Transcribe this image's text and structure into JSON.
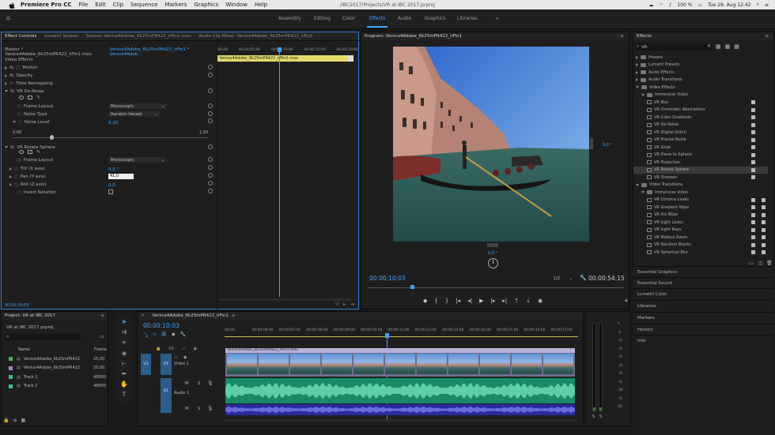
{
  "menubar": {
    "app": "Premiere Pro CC",
    "items": [
      "File",
      "Edit",
      "Clip",
      "Sequence",
      "Markers",
      "Graphics",
      "Window",
      "Help"
    ],
    "project_path": "/IBC2017/Projects/VR at IBC 2017.prproj",
    "battery": "100 %",
    "datetime": "Tue 29. Aug  12:42"
  },
  "workspaces": {
    "items": [
      "Assembly",
      "Editing",
      "Color",
      "Effects",
      "Audio",
      "Graphics",
      "Libraries"
    ],
    "active": "Effects",
    "more": "»"
  },
  "effect_controls": {
    "tabs": [
      "Effect Controls",
      "Lumetri Scopes",
      "Source: Venice4Adobe_6k25mPR422_irFin1.mov",
      "Audio Clip Mixer: Venice4Adobe_6k25mPR422_irFin1"
    ],
    "master": "Master * Venice4Adobe_6k25mPR422_irFin1.mov",
    "sequence_clip": "Venice4Adobe_6k25mPR422_irFin1 * Venice4Adob...",
    "section": "Video Effects",
    "motion": "Motion",
    "opacity": "Opacity",
    "time_remapping": "Time Remapping",
    "vr_denoise": "VR De-Noise",
    "frame_layout_label": "Frame Layout",
    "frame_layout_value": "Monoscopic",
    "noise_type_label": "Noise Type",
    "noise_type_value": "Random Valued",
    "noise_level_label": "Noise Level",
    "noise_level_value": "0,20",
    "slider_min": "0,00",
    "slider_max": "1,00",
    "vr_rotate": "VR Rotate Sphere",
    "frame_layout2_label": "Frame Layout",
    "frame_layout2_value": "Monoscopic",
    "tilt_label": "Tilt (X axis)",
    "tilt_value": "0,0 °",
    "pan_label": "Pan (Y axis)",
    "pan_value": "41,0",
    "roll_label": "Roll (Z axis)",
    "roll_value": "0,0",
    "invert_label": "Invert Rotation",
    "timecode": "00;00;10;03",
    "mini_ruler": [
      "00;00",
      "00;00;05;00",
      "00;00;10;00",
      "00;00;15;00",
      "00;00;20;00"
    ],
    "mini_clip": "Venice4Adobe_6k25mPR422_irFin1.mov"
  },
  "program_monitor": {
    "title": "Program: Venice4Adobe_6k25mPR422_irFin1",
    "angle_right": "0,0 °",
    "angle_bottom": "0,0 °",
    "timecode": "00:00:10:03",
    "zoom": "1/2",
    "duration": "00:00:54:15"
  },
  "effects_panel": {
    "title": "Effects",
    "search_value": "VR",
    "items": [
      {
        "label": "Presets",
        "level": 0,
        "type": "folder",
        "open": false
      },
      {
        "label": "Lumetri Presets",
        "level": 0,
        "type": "folder",
        "open": false
      },
      {
        "label": "Audio Effects",
        "level": 0,
        "type": "folder",
        "open": false
      },
      {
        "label": "Audio Transitions",
        "level": 0,
        "type": "folder",
        "open": false
      },
      {
        "label": "Video Effects",
        "level": 0,
        "type": "folder",
        "open": true
      },
      {
        "label": "Immersive Video",
        "level": 1,
        "type": "folder",
        "open": true
      },
      {
        "label": "VR Blur",
        "level": 2,
        "type": "fx",
        "badges": 1
      },
      {
        "label": "VR Chromatic Aberrations",
        "level": 2,
        "type": "fx",
        "badges": 1
      },
      {
        "label": "VR Color Gradients",
        "level": 2,
        "type": "fx",
        "badges": 1
      },
      {
        "label": "VR De-Noise",
        "level": 2,
        "type": "fx",
        "badges": 1
      },
      {
        "label": "VR Digital Glitch",
        "level": 2,
        "type": "fx",
        "badges": 1
      },
      {
        "label": "VR Fractal Noise",
        "level": 2,
        "type": "fx",
        "badges": 1
      },
      {
        "label": "VR Glow",
        "level": 2,
        "type": "fx",
        "badges": 1
      },
      {
        "label": "VR Plane to Sphere",
        "level": 2,
        "type": "fx",
        "badges": 1
      },
      {
        "label": "VR Projection",
        "level": 2,
        "type": "fx",
        "badges": 1
      },
      {
        "label": "VR Rotate Sphere",
        "level": 2,
        "type": "fx",
        "badges": 1,
        "selected": true
      },
      {
        "label": "VR Sharpen",
        "level": 2,
        "type": "fx",
        "badges": 1
      },
      {
        "label": "Video Transitions",
        "level": 0,
        "type": "folder",
        "open": true
      },
      {
        "label": "Immersive Video",
        "level": 1,
        "type": "folder",
        "open": true
      },
      {
        "label": "VR Chroma Leaks",
        "level": 2,
        "type": "fx",
        "badges": 2
      },
      {
        "label": "VR Gradient Wipe",
        "level": 2,
        "type": "fx",
        "badges": 2
      },
      {
        "label": "VR Iris Wipe",
        "level": 2,
        "type": "fx",
        "badges": 2
      },
      {
        "label": "VR Light Leaks",
        "level": 2,
        "type": "fx",
        "badges": 2
      },
      {
        "label": "VR Light Rays",
        "level": 2,
        "type": "fx",
        "badges": 2
      },
      {
        "label": "VR Mobius Zoom",
        "level": 2,
        "type": "fx",
        "badges": 2
      },
      {
        "label": "VR Random Blocks",
        "level": 2,
        "type": "fx",
        "badges": 2
      },
      {
        "label": "VR Spherical Blur",
        "level": 2,
        "type": "fx",
        "badges": 2
      }
    ],
    "stacked": [
      "Essential Graphics",
      "Essential Sound",
      "Lumetri Color",
      "Libraries",
      "Markers",
      "History",
      "Info"
    ]
  },
  "project_panel": {
    "title": "Project: VR at IBC 2017",
    "file": "VR at IBC 2017.prproj",
    "col_name": "Name",
    "col_frame": "Frame",
    "items": [
      {
        "name": "Venice4Adobe_6k25mPR422",
        "rate": "25,00",
        "color": "#4fb34f"
      },
      {
        "name": "Venice4Adobe_6k25mPR422",
        "rate": "25,00",
        "color": "#a58ad6"
      },
      {
        "name": "Track 1",
        "rate": "48000",
        "color": "#3bbf8f"
      },
      {
        "name": "Track 2",
        "rate": "48000",
        "color": "#3bbf8f"
      }
    ]
  },
  "timeline": {
    "title": "Venice4Adobe_6k25mPR422_irFin1",
    "timecode": "00:00:10:03",
    "ruler": [
      "04:00",
      "00:00:06:00",
      "00:00:07:00",
      "00:00:08:00",
      "00:00:09:00",
      "00:00:10:00",
      "00:00:11:00",
      "00:00:12:00",
      "00:00:13:00",
      "00:00:14:00",
      "00:00:15:00",
      "00:00:16:00",
      "00:00:17:00"
    ],
    "v1": "V1",
    "v2": "V2",
    "v1_target": "V1",
    "a1": "A1",
    "a1_src": "A1",
    "video_track_name": "Video 1",
    "audio_track_name": "Audio 1",
    "clip_label": "Venice4Adobe_6k25mPR422_irFin1.mov",
    "mute": "M",
    "solo": "S"
  },
  "meters": {
    "labels": [
      "0",
      "-6",
      "-12",
      "-18",
      "-24",
      "-30",
      "-36",
      "-42",
      "-48",
      "-54",
      "dB"
    ]
  }
}
